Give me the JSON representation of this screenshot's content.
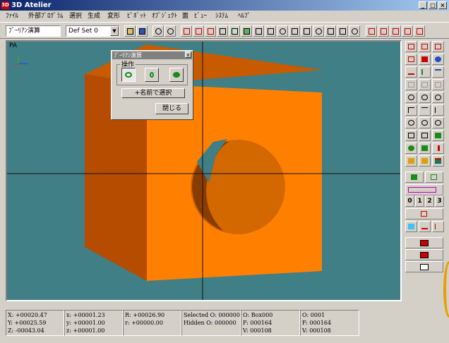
{
  "app": {
    "title": "3D Atelier",
    "icon_text": "3D"
  },
  "window_controls": {
    "minimize": "_",
    "restore": "□",
    "close": "×"
  },
  "menu": [
    "ﾌｧｲﾙ",
    "外部ﾌﾟﾛｸﾞﾗﾑ",
    "選択",
    "生成",
    "変形",
    "ﾋﾟﾎﾞｯﾄ",
    "ｵﾌﾞｼﾞｪｸﾄ",
    "面",
    "ﾋﾞｭｰ",
    "ｼｽﾃﾑ",
    "ﾍﾙﾌﾟ"
  ],
  "toolbar": {
    "mode_combo": "ﾌﾞｰﾘｱﾝ演算",
    "set_combo": "Def Set 0",
    "combo_arrow": "▼"
  },
  "viewport": {
    "label": "PA",
    "background": "#3f7f85",
    "object_color": "#ff8000"
  },
  "dialog": {
    "title": "ﾌﾞｰﾘｱﾝ演算",
    "close": "x",
    "group_label": "操作",
    "select_by_name": "+名前で選択",
    "close_button": "閉じる"
  },
  "status": {
    "col1": [
      "X: +00020.47",
      "Y: +00025.59",
      "Z: -00043.04"
    ],
    "col2": [
      "x: +00001.23",
      "y: +00001.00",
      "z: +00001.00"
    ],
    "col3": [
      "R: +00026.90",
      "r: +00000.00"
    ],
    "col4": [
      "Selected O: 000000",
      "Hidden O: 000000"
    ],
    "col5": [
      "O: Box000",
      "F: 000164",
      "V: 000108"
    ],
    "col6": [
      "O: 0001",
      "F: 000164",
      "V: 000108"
    ]
  },
  "panel": {
    "layer_buttons": [
      "0",
      "1",
      "2",
      "3"
    ]
  }
}
